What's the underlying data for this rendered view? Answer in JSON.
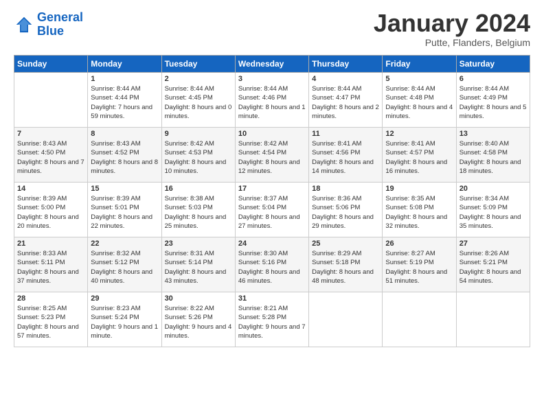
{
  "header": {
    "logo_line1": "General",
    "logo_line2": "Blue",
    "month_title": "January 2024",
    "subtitle": "Putte, Flanders, Belgium"
  },
  "days_of_week": [
    "Sunday",
    "Monday",
    "Tuesday",
    "Wednesday",
    "Thursday",
    "Friday",
    "Saturday"
  ],
  "weeks": [
    [
      {
        "day": "",
        "sunrise": "",
        "sunset": "",
        "daylight": ""
      },
      {
        "day": "1",
        "sunrise": "Sunrise: 8:44 AM",
        "sunset": "Sunset: 4:44 PM",
        "daylight": "Daylight: 7 hours and 59 minutes."
      },
      {
        "day": "2",
        "sunrise": "Sunrise: 8:44 AM",
        "sunset": "Sunset: 4:45 PM",
        "daylight": "Daylight: 8 hours and 0 minutes."
      },
      {
        "day": "3",
        "sunrise": "Sunrise: 8:44 AM",
        "sunset": "Sunset: 4:46 PM",
        "daylight": "Daylight: 8 hours and 1 minute."
      },
      {
        "day": "4",
        "sunrise": "Sunrise: 8:44 AM",
        "sunset": "Sunset: 4:47 PM",
        "daylight": "Daylight: 8 hours and 2 minutes."
      },
      {
        "day": "5",
        "sunrise": "Sunrise: 8:44 AM",
        "sunset": "Sunset: 4:48 PM",
        "daylight": "Daylight: 8 hours and 4 minutes."
      },
      {
        "day": "6",
        "sunrise": "Sunrise: 8:44 AM",
        "sunset": "Sunset: 4:49 PM",
        "daylight": "Daylight: 8 hours and 5 minutes."
      }
    ],
    [
      {
        "day": "7",
        "sunrise": "Sunrise: 8:43 AM",
        "sunset": "Sunset: 4:50 PM",
        "daylight": "Daylight: 8 hours and 7 minutes."
      },
      {
        "day": "8",
        "sunrise": "Sunrise: 8:43 AM",
        "sunset": "Sunset: 4:52 PM",
        "daylight": "Daylight: 8 hours and 8 minutes."
      },
      {
        "day": "9",
        "sunrise": "Sunrise: 8:42 AM",
        "sunset": "Sunset: 4:53 PM",
        "daylight": "Daylight: 8 hours and 10 minutes."
      },
      {
        "day": "10",
        "sunrise": "Sunrise: 8:42 AM",
        "sunset": "Sunset: 4:54 PM",
        "daylight": "Daylight: 8 hours and 12 minutes."
      },
      {
        "day": "11",
        "sunrise": "Sunrise: 8:41 AM",
        "sunset": "Sunset: 4:56 PM",
        "daylight": "Daylight: 8 hours and 14 minutes."
      },
      {
        "day": "12",
        "sunrise": "Sunrise: 8:41 AM",
        "sunset": "Sunset: 4:57 PM",
        "daylight": "Daylight: 8 hours and 16 minutes."
      },
      {
        "day": "13",
        "sunrise": "Sunrise: 8:40 AM",
        "sunset": "Sunset: 4:58 PM",
        "daylight": "Daylight: 8 hours and 18 minutes."
      }
    ],
    [
      {
        "day": "14",
        "sunrise": "Sunrise: 8:39 AM",
        "sunset": "Sunset: 5:00 PM",
        "daylight": "Daylight: 8 hours and 20 minutes."
      },
      {
        "day": "15",
        "sunrise": "Sunrise: 8:39 AM",
        "sunset": "Sunset: 5:01 PM",
        "daylight": "Daylight: 8 hours and 22 minutes."
      },
      {
        "day": "16",
        "sunrise": "Sunrise: 8:38 AM",
        "sunset": "Sunset: 5:03 PM",
        "daylight": "Daylight: 8 hours and 25 minutes."
      },
      {
        "day": "17",
        "sunrise": "Sunrise: 8:37 AM",
        "sunset": "Sunset: 5:04 PM",
        "daylight": "Daylight: 8 hours and 27 minutes."
      },
      {
        "day": "18",
        "sunrise": "Sunrise: 8:36 AM",
        "sunset": "Sunset: 5:06 PM",
        "daylight": "Daylight: 8 hours and 29 minutes."
      },
      {
        "day": "19",
        "sunrise": "Sunrise: 8:35 AM",
        "sunset": "Sunset: 5:08 PM",
        "daylight": "Daylight: 8 hours and 32 minutes."
      },
      {
        "day": "20",
        "sunrise": "Sunrise: 8:34 AM",
        "sunset": "Sunset: 5:09 PM",
        "daylight": "Daylight: 8 hours and 35 minutes."
      }
    ],
    [
      {
        "day": "21",
        "sunrise": "Sunrise: 8:33 AM",
        "sunset": "Sunset: 5:11 PM",
        "daylight": "Daylight: 8 hours and 37 minutes."
      },
      {
        "day": "22",
        "sunrise": "Sunrise: 8:32 AM",
        "sunset": "Sunset: 5:12 PM",
        "daylight": "Daylight: 8 hours and 40 minutes."
      },
      {
        "day": "23",
        "sunrise": "Sunrise: 8:31 AM",
        "sunset": "Sunset: 5:14 PM",
        "daylight": "Daylight: 8 hours and 43 minutes."
      },
      {
        "day": "24",
        "sunrise": "Sunrise: 8:30 AM",
        "sunset": "Sunset: 5:16 PM",
        "daylight": "Daylight: 8 hours and 46 minutes."
      },
      {
        "day": "25",
        "sunrise": "Sunrise: 8:29 AM",
        "sunset": "Sunset: 5:18 PM",
        "daylight": "Daylight: 8 hours and 48 minutes."
      },
      {
        "day": "26",
        "sunrise": "Sunrise: 8:27 AM",
        "sunset": "Sunset: 5:19 PM",
        "daylight": "Daylight: 8 hours and 51 minutes."
      },
      {
        "day": "27",
        "sunrise": "Sunrise: 8:26 AM",
        "sunset": "Sunset: 5:21 PM",
        "daylight": "Daylight: 8 hours and 54 minutes."
      }
    ],
    [
      {
        "day": "28",
        "sunrise": "Sunrise: 8:25 AM",
        "sunset": "Sunset: 5:23 PM",
        "daylight": "Daylight: 8 hours and 57 minutes."
      },
      {
        "day": "29",
        "sunrise": "Sunrise: 8:23 AM",
        "sunset": "Sunset: 5:24 PM",
        "daylight": "Daylight: 9 hours and 1 minute."
      },
      {
        "day": "30",
        "sunrise": "Sunrise: 8:22 AM",
        "sunset": "Sunset: 5:26 PM",
        "daylight": "Daylight: 9 hours and 4 minutes."
      },
      {
        "day": "31",
        "sunrise": "Sunrise: 8:21 AM",
        "sunset": "Sunset: 5:28 PM",
        "daylight": "Daylight: 9 hours and 7 minutes."
      },
      {
        "day": "",
        "sunrise": "",
        "sunset": "",
        "daylight": ""
      },
      {
        "day": "",
        "sunrise": "",
        "sunset": "",
        "daylight": ""
      },
      {
        "day": "",
        "sunrise": "",
        "sunset": "",
        "daylight": ""
      }
    ]
  ]
}
